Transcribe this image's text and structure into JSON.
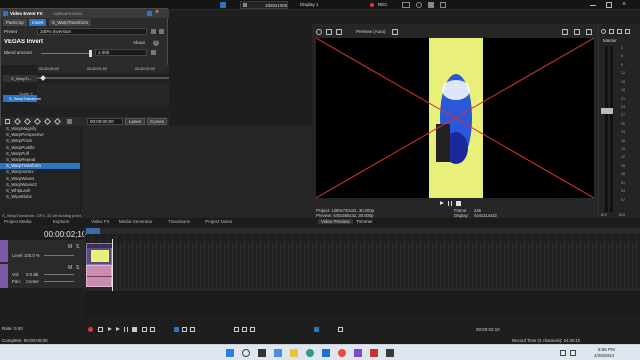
{
  "topbar": {
    "resolution": "1920x1080",
    "display": "Display 1",
    "rec": "REC"
  },
  "fx_dialog": {
    "title": "Video Event FX",
    "subtitle": "VidPlusFXGDH1",
    "tabs": [
      "PanCrop",
      "Invert",
      "S_WarpTransform"
    ],
    "preset_label": "Preset",
    "preset_value": "100% Inversion",
    "plugin_name": "VEGAS Invert",
    "about_label": "About",
    "blend_label": "Blend amount",
    "blend_value": "1.000",
    "time_marks": [
      "00:00:00;00",
      "00:00:01;00",
      "00:00:02;00"
    ],
    "track_a": "S_WarpTr...",
    "track_b": "Scale X",
    "track_c": "S_WarpTransform",
    "timecode": "00:00:00;00",
    "lanes_label": "Lanes",
    "curves_label": "Curves"
  },
  "fx_list": {
    "items": [
      "S_WarpMagnify",
      "S_WarpPerspective",
      "S_WarpPrism",
      "S_WarpPuddle",
      "S_WarpPuff",
      "S_WarpRepeat",
      "S_WarpTransform",
      "S_WarpVortex",
      "S_WarpWaves",
      "S_WarpWaves2",
      "S_WhipLash",
      "S_WipeBlobs"
    ],
    "selected_index": 6,
    "status": "S_WarpTransform: OFX, 32-bit floating point, Grouping: Sapphire.Distort, Version: 1.0E10"
  },
  "preview": {
    "label": "Preview (Auto)",
    "project": "Project:  1280x720x32, 30.000p",
    "preview_res": "Preview: 640x360x32, 30.000p",
    "frame_label": "Frame:",
    "frame_value": "245",
    "display_label": "Display:",
    "display_value": "444x314x32",
    "tab_video_preview": "Video Preview",
    "tab_trimmer": "Trimmer"
  },
  "master": {
    "title": "Master",
    "volume_label": "Master Bus",
    "scale": [
      "3",
      "6",
      "9",
      "12",
      "15",
      "18",
      "21",
      "24",
      "27",
      "30",
      "33",
      "36",
      "39",
      "42",
      "45",
      "48",
      "51",
      "54",
      "57"
    ],
    "bottom_values": [
      "0.0",
      "0.0"
    ]
  },
  "bottom_tabs": [
    "Project Media",
    "Explorer",
    "Video FX",
    "Media Generator",
    "Transitions",
    "Project Notes"
  ],
  "timeline": {
    "timecode": "00:00:02;10",
    "level_label": "Level:",
    "level_value": "100.0 %",
    "vol_label": "Vol:",
    "vol_value": "0.0 dB",
    "pan_label": "Pan:",
    "pan_value": "Center",
    "rate_label": "Rate:",
    "rate_value": "0.00",
    "end_timecode": "00:00:02;10",
    "record_time": "Record Time (2 channels): 24:30:15"
  },
  "statusbar": {
    "complete": "Complete: 00:00:00;00"
  },
  "taskbar": {
    "time": "8:55 PM",
    "date": "4/28/2024"
  },
  "colors": {
    "accent": "#2d73c4",
    "preview_yellow": "#e8f07a",
    "x_line": "#d23232",
    "rec_red": "#e23b3b",
    "clip_pink": "#c98bb0"
  }
}
